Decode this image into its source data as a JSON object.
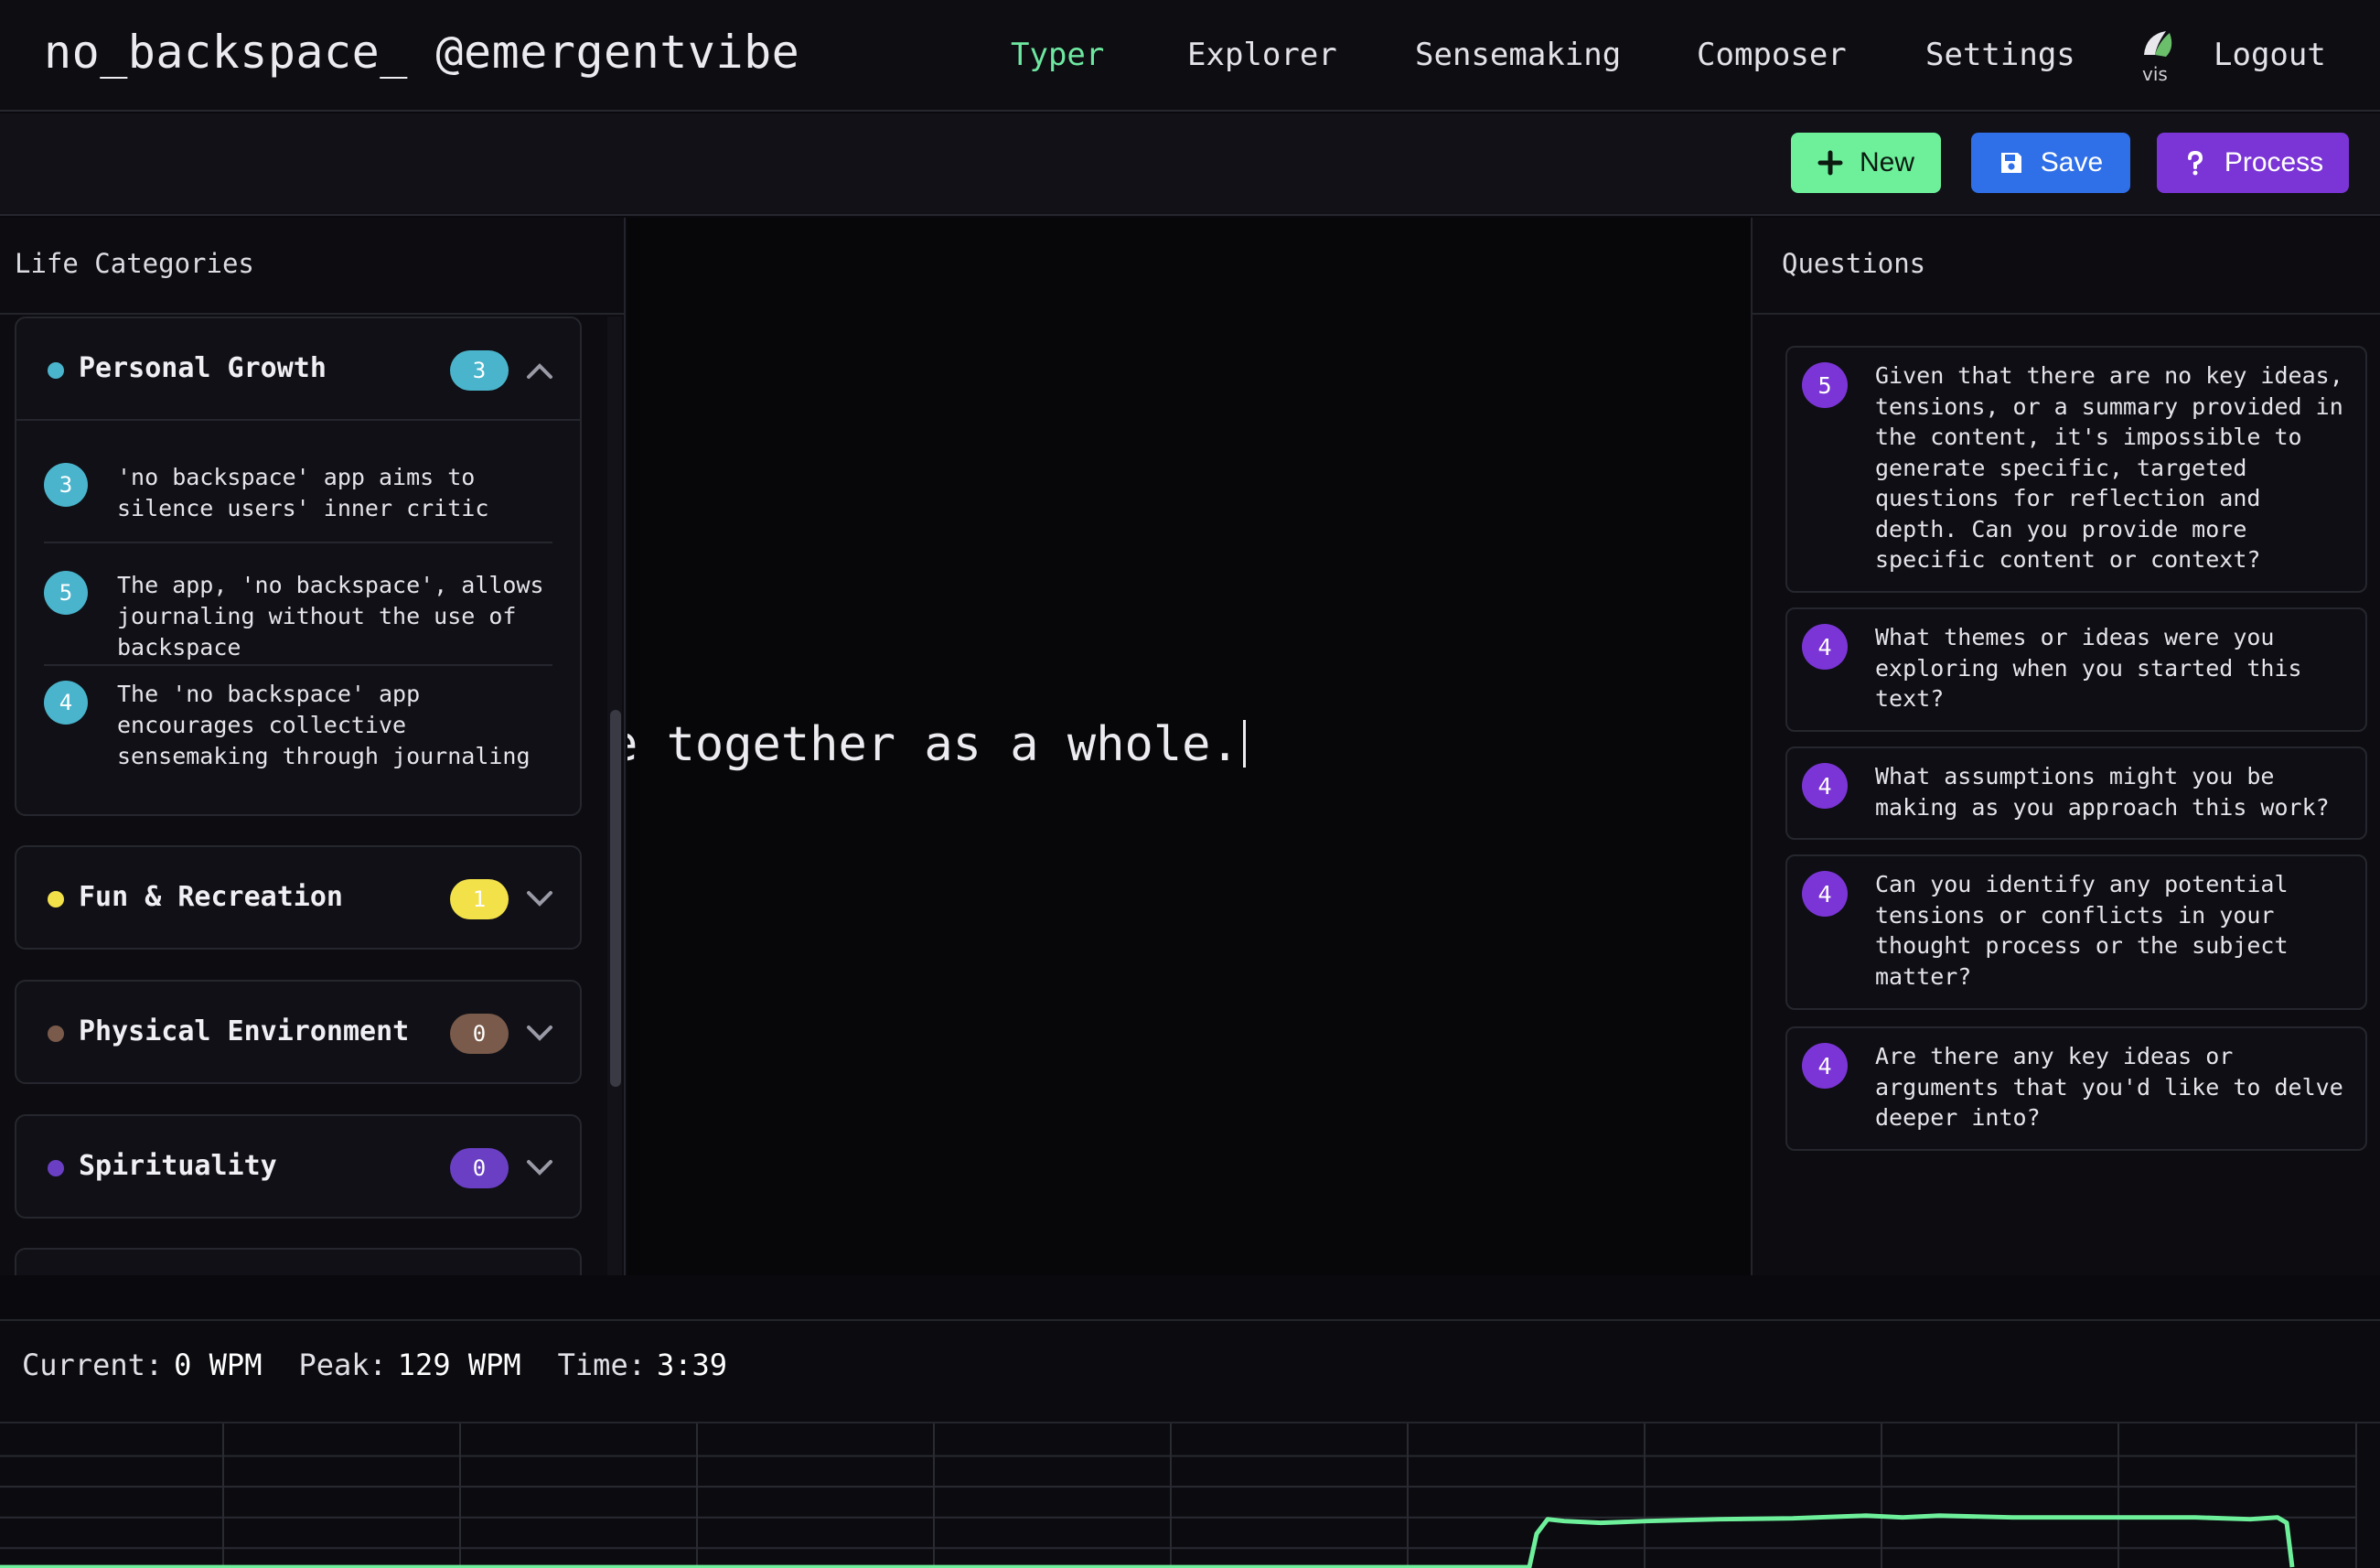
{
  "nav": {
    "brand": "no_backspace_ @emergentvibe",
    "links": [
      "Typer",
      "Explorer",
      "Sensemaking",
      "Composer",
      "Settings"
    ],
    "active": "Typer",
    "logout": "Logout",
    "avatar_alt": "vis"
  },
  "toolbar": {
    "new_label": "New",
    "save_label": "Save",
    "process_label": "Process"
  },
  "left_panel": {
    "title": "Life Categories",
    "categories": [
      {
        "name": "Personal Growth",
        "count": "3",
        "color": "#4ab4cc",
        "expanded": true,
        "insights": [
          {
            "score": "3",
            "text": "'no backspace' app aims to silence users' inner critic"
          },
          {
            "score": "5",
            "text": "The app, 'no backspace', allows journaling without the use of backspace"
          },
          {
            "score": "4",
            "text": "The 'no backspace' app encourages collective sensemaking through journaling"
          }
        ]
      },
      {
        "name": "Fun & Recreation",
        "count": "1",
        "color": "#f3e14a",
        "expanded": false
      },
      {
        "name": "Physical Environment",
        "count": "0",
        "color": "#7a5a4a",
        "expanded": false
      },
      {
        "name": "Spirituality",
        "count": "0",
        "color": "#6a3fc4",
        "expanded": false
      }
    ]
  },
  "editor": {
    "text": "e together as a whole."
  },
  "right_panel": {
    "title": "Questions",
    "questions": [
      {
        "score": "5",
        "text": "Given that there are no key ideas, tensions, or a summary provided in the content, it's impossible to generate specific, targeted questions for reflection and depth. Can you provide more specific content or context?"
      },
      {
        "score": "4",
        "text": "What themes or ideas were you exploring when you started this text?"
      },
      {
        "score": "4",
        "text": "What assumptions might you be making as you approach this work?"
      },
      {
        "score": "4",
        "text": "Can you identify any potential tensions or conflicts in your thought process or the subject matter?"
      },
      {
        "score": "4",
        "text": "Are there any key ideas or arguments that you'd like to delve deeper into?"
      }
    ]
  },
  "stats": {
    "current_label": "Current:",
    "current_value": "0 WPM",
    "peak_label": "Peak:",
    "peak_value": "129 WPM",
    "time_label": "Time:",
    "time_value": "3:39"
  },
  "wpm_chart": {
    "line_color": "#6ef09b",
    "grid_color": "#2a2a32"
  }
}
